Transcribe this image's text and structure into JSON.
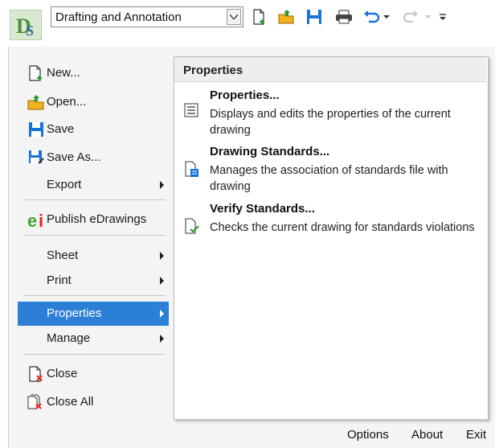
{
  "toolbar": {
    "workspace_value": "Drafting and Annotation",
    "buttons": [
      "new-icon",
      "open-icon",
      "save-icon",
      "print-icon",
      "undo-icon",
      "redo-icon",
      "customize-icon"
    ]
  },
  "left_menu": {
    "new": "New...",
    "open": "Open...",
    "save": "Save",
    "save_as": "Save As...",
    "export": "Export",
    "publish": "Publish eDrawings",
    "sheet": "Sheet",
    "print": "Print",
    "properties": "Properties",
    "manage": "Manage",
    "close": "Close",
    "close_all": "Close All"
  },
  "submenu": {
    "header": "Properties",
    "items": [
      {
        "title": "Properties...",
        "desc": "Displays and edits the properties of the current drawing"
      },
      {
        "title": "Drawing Standards...",
        "desc": "Manages the association of standards file with drawing"
      },
      {
        "title": "Verify Standards...",
        "desc": "Checks the current drawing for standards violations"
      }
    ]
  },
  "footer": {
    "options": "Options",
    "about": "About",
    "exit": "Exit"
  },
  "colors": {
    "selection": "#2b7fd6",
    "accent_blue": "#1a73d9",
    "folder_yellow": "#f2b21c"
  }
}
